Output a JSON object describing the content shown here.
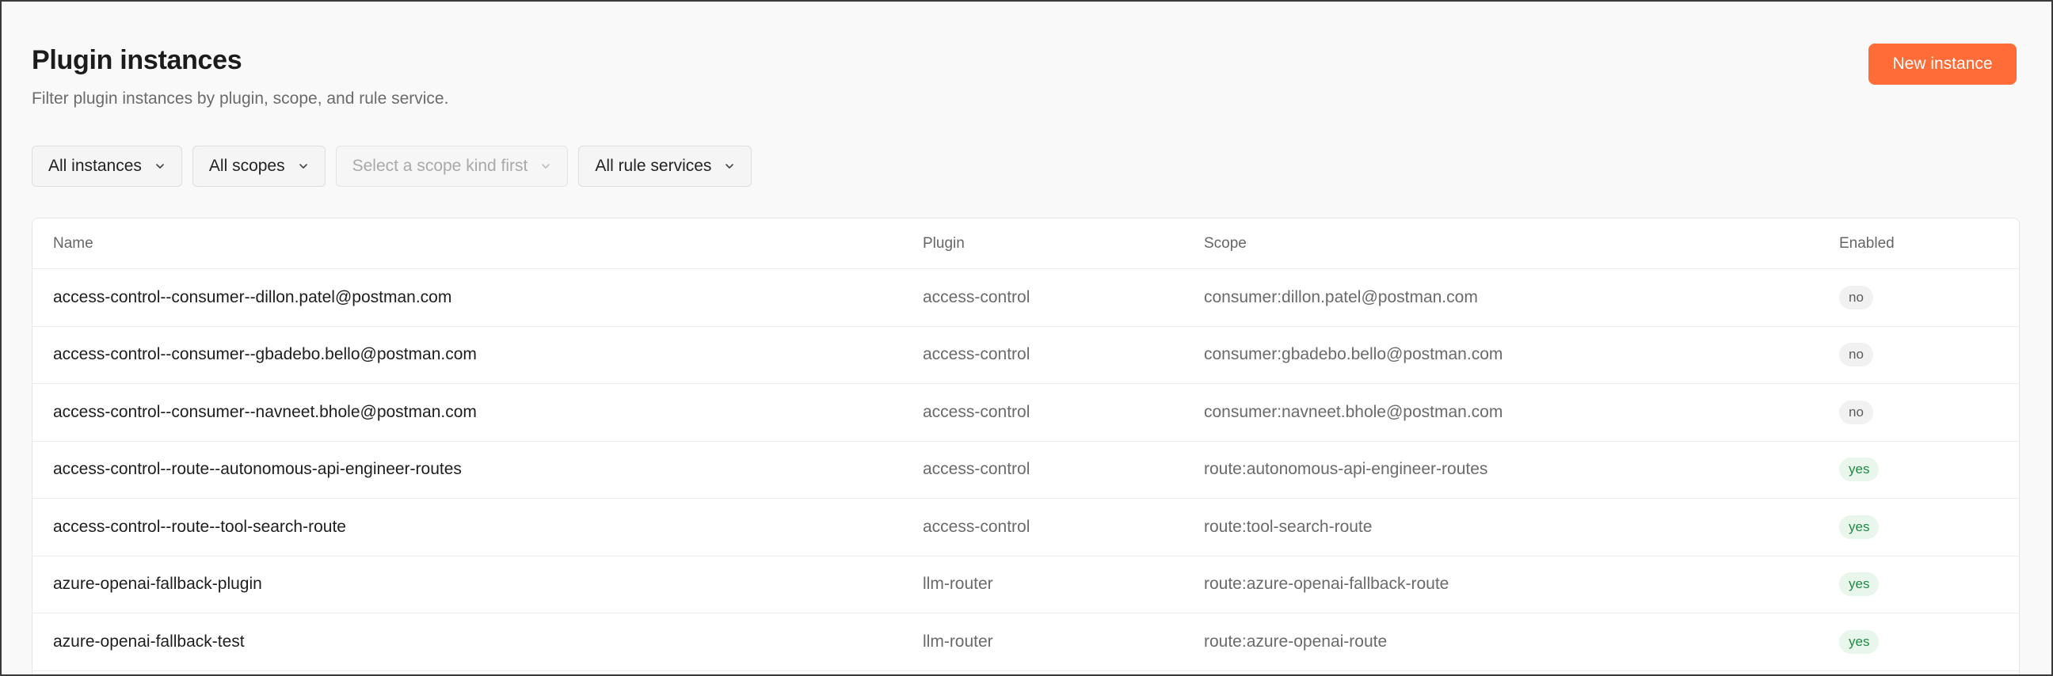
{
  "header": {
    "title": "Plugin instances",
    "subtitle": "Filter plugin instances by plugin, scope, and rule service.",
    "new_button_label": "New instance"
  },
  "filters": {
    "instances": "All instances",
    "scopes": "All scopes",
    "scope_value_placeholder": "Select a scope kind first",
    "rule_services": "All rule services"
  },
  "table": {
    "columns": {
      "name": "Name",
      "plugin": "Plugin",
      "scope": "Scope",
      "enabled": "Enabled"
    },
    "rows": [
      {
        "name": "access-control--consumer--dillon.patel@postman.com",
        "plugin": "access-control",
        "scope": "consumer:dillon.patel@postman.com",
        "enabled": "no"
      },
      {
        "name": "access-control--consumer--gbadebo.bello@postman.com",
        "plugin": "access-control",
        "scope": "consumer:gbadebo.bello@postman.com",
        "enabled": "no"
      },
      {
        "name": "access-control--consumer--navneet.bhole@postman.com",
        "plugin": "access-control",
        "scope": "consumer:navneet.bhole@postman.com",
        "enabled": "no"
      },
      {
        "name": "access-control--route--autonomous-api-engineer-routes",
        "plugin": "access-control",
        "scope": "route:autonomous-api-engineer-routes",
        "enabled": "yes"
      },
      {
        "name": "access-control--route--tool-search-route",
        "plugin": "access-control",
        "scope": "route:tool-search-route",
        "enabled": "yes"
      },
      {
        "name": "azure-openai-fallback-plugin",
        "plugin": "llm-router",
        "scope": "route:azure-openai-fallback-route",
        "enabled": "yes"
      },
      {
        "name": "azure-openai-fallback-test",
        "plugin": "llm-router",
        "scope": "route:azure-openai-route",
        "enabled": "yes"
      }
    ]
  },
  "colors": {
    "accent": "#ff6c37",
    "enabled_yes_bg": "#e8f6ec",
    "enabled_yes_text": "#1f8a45",
    "enabled_no_bg": "#f1f1f1"
  },
  "icons": {
    "dropdown": "chevron-down-icon"
  }
}
